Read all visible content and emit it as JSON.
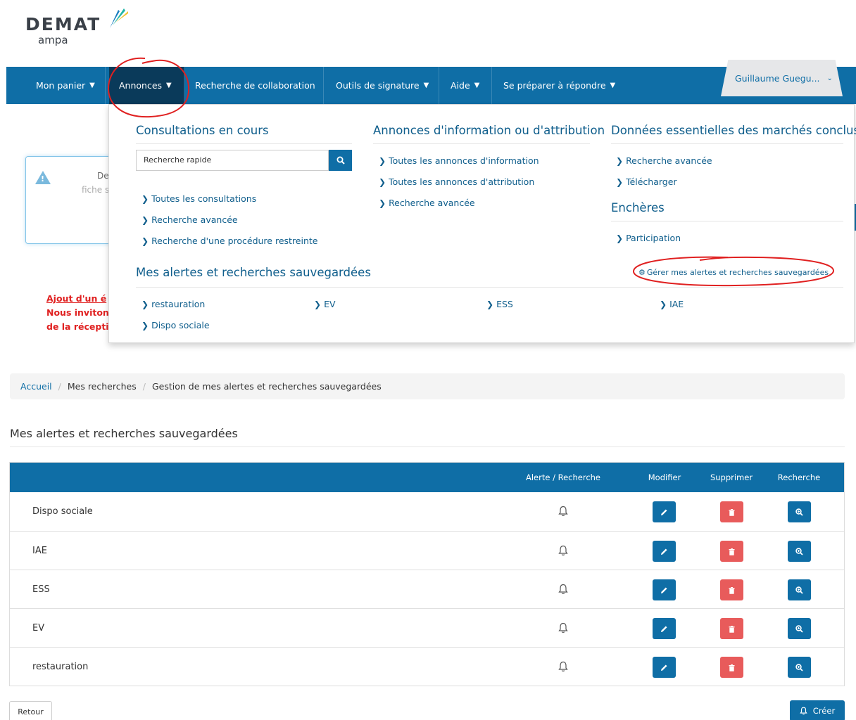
{
  "logo": {
    "word": "DEMAT",
    "sub": "ampa"
  },
  "nav": {
    "items": [
      {
        "label": "Mon panier",
        "chevron": true
      },
      {
        "label": "Annonces",
        "chevron": true,
        "active": true
      },
      {
        "label": "Recherche de collaboration",
        "chevron": false
      },
      {
        "label": "Outils de signature",
        "chevron": true
      },
      {
        "label": "Aide",
        "chevron": true
      },
      {
        "label": "Se préparer à répondre",
        "chevron": true
      }
    ],
    "user": "Guillaume Guegu..."
  },
  "background": {
    "card_text_1": "De",
    "card_text_2": "fiche s",
    "red_line_1": "Ajout d'un é",
    "red_line_2": "Nous inviton",
    "red_line_3": "de la récepti"
  },
  "mega": {
    "col1": {
      "title": "Consultations en cours",
      "search_placeholder": "Recherche rapide",
      "links": [
        "Toutes les consultations",
        "Recherche avancée",
        "Recherche d'une procédure restreinte"
      ]
    },
    "col2": {
      "title": "Annonces d'information ou d'attribution",
      "links": [
        "Toutes les annonces d'information",
        "Toutes les annonces d'attribution",
        "Recherche avancée"
      ]
    },
    "col3": {
      "title": "Données essentielles des marchés conclus",
      "links": [
        "Recherche avancée",
        "Télécharger"
      ],
      "title2": "Enchères",
      "links2": [
        "Participation"
      ]
    },
    "alerts": {
      "title": "Mes alertes et recherches sauvegardées",
      "manage": "Gérer mes alertes et recherches sauvegardées",
      "items": [
        "restauration",
        "EV",
        "ESS",
        "IAE",
        "Dispo sociale"
      ]
    }
  },
  "breadcrumb": {
    "home": "Accueil",
    "level2": "Mes recherches",
    "current": "Gestion de mes alertes et recherches sauvegardées"
  },
  "page_title": "Mes alertes et recherches sauvegardées",
  "table": {
    "headers": {
      "type": "Alerte / Recherche",
      "edit": "Modifier",
      "delete": "Supprimer",
      "search": "Recherche"
    },
    "rows": [
      {
        "name": "Dispo sociale",
        "type_icon": "bell-icon"
      },
      {
        "name": "IAE",
        "type_icon": "bell-icon"
      },
      {
        "name": "ESS",
        "type_icon": "bell-icon"
      },
      {
        "name": "EV",
        "type_icon": "bell-icon"
      },
      {
        "name": "restauration",
        "type_icon": "bell-icon"
      }
    ]
  },
  "buttons": {
    "back": "Retour",
    "create": "Créer"
  },
  "colors": {
    "primary": "#0f6ea6",
    "danger": "#e85b5b",
    "annotation": "#e02020"
  }
}
